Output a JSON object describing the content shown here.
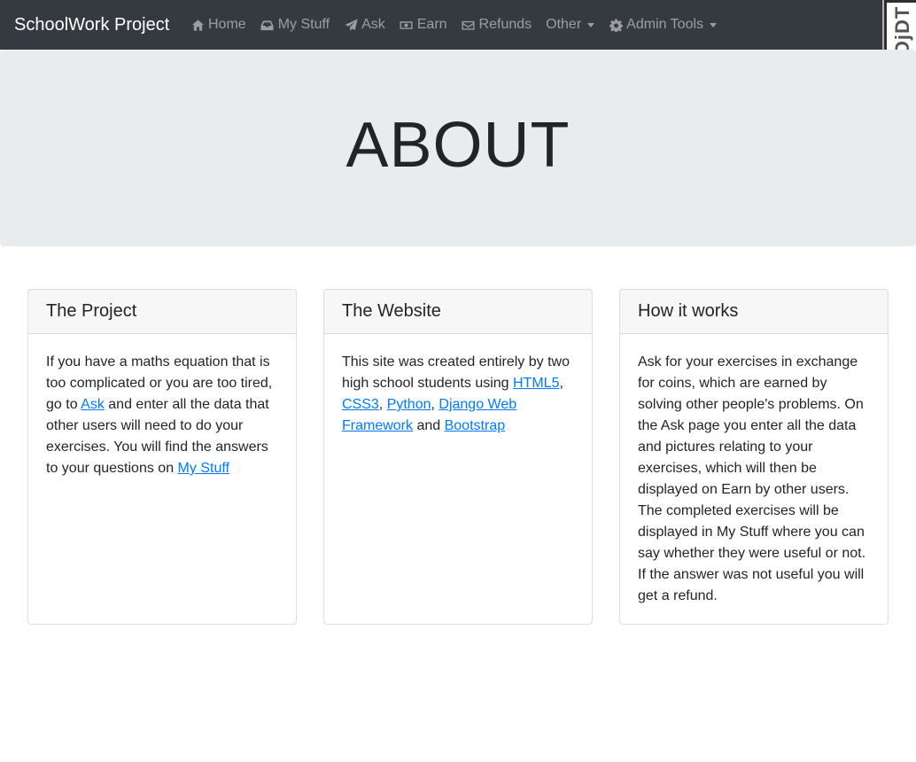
{
  "navbar": {
    "brand": "SchoolWork Project",
    "items": [
      {
        "label": "Home",
        "icon": "home-icon"
      },
      {
        "label": "My Stuff",
        "icon": "inbox-icon"
      },
      {
        "label": "Ask",
        "icon": "paper-plane-icon"
      },
      {
        "label": "Earn",
        "icon": "money-bill-icon"
      },
      {
        "label": "Refunds",
        "icon": "envelope-icon"
      },
      {
        "label": "Other",
        "icon": null,
        "dropdown": true
      },
      {
        "label": "Admin Tools",
        "icon": "gear-icon",
        "dropdown": true
      }
    ],
    "colors": {
      "background": "#343a40",
      "brand": "#ffffff",
      "link": "rgba(255,255,255,0.5)"
    }
  },
  "debug_toolbar": {
    "label": "DjDT"
  },
  "jumbotron": {
    "title": "ABOUT",
    "background": "#e9ecef"
  },
  "cards": [
    {
      "title": "The Project",
      "text": {
        "t1": "If you have a maths equation that is too complicated or you are too tired, go to ",
        "link1": "Ask",
        "t2": " and enter all the data that other users will need to do your exercises. You will find the answers to your questions on ",
        "link2": "My Stuff"
      }
    },
    {
      "title": "The Website",
      "text": {
        "t1": "This site was created entirely by two high school students using ",
        "link1": "HTML5",
        "t2": ", ",
        "link2": "CSS3",
        "t3": ", ",
        "link3": "Python",
        "t4": ", ",
        "link4": "Django Web Framework",
        "t5": " and ",
        "link5": "Bootstrap"
      }
    },
    {
      "title": "How it works",
      "text": {
        "t1": "Ask for your exercises in exchange for coins, which are earned by solving other people's problems. On the Ask page you enter all the data and pictures relating to your exercises, which will then be displayed on Earn by other users. The completed exercises will be displayed in My Stuff where you can say whether they were useful or not. If the answer was not useful you will get a refund."
      }
    }
  ],
  "link_color": "#007bff"
}
